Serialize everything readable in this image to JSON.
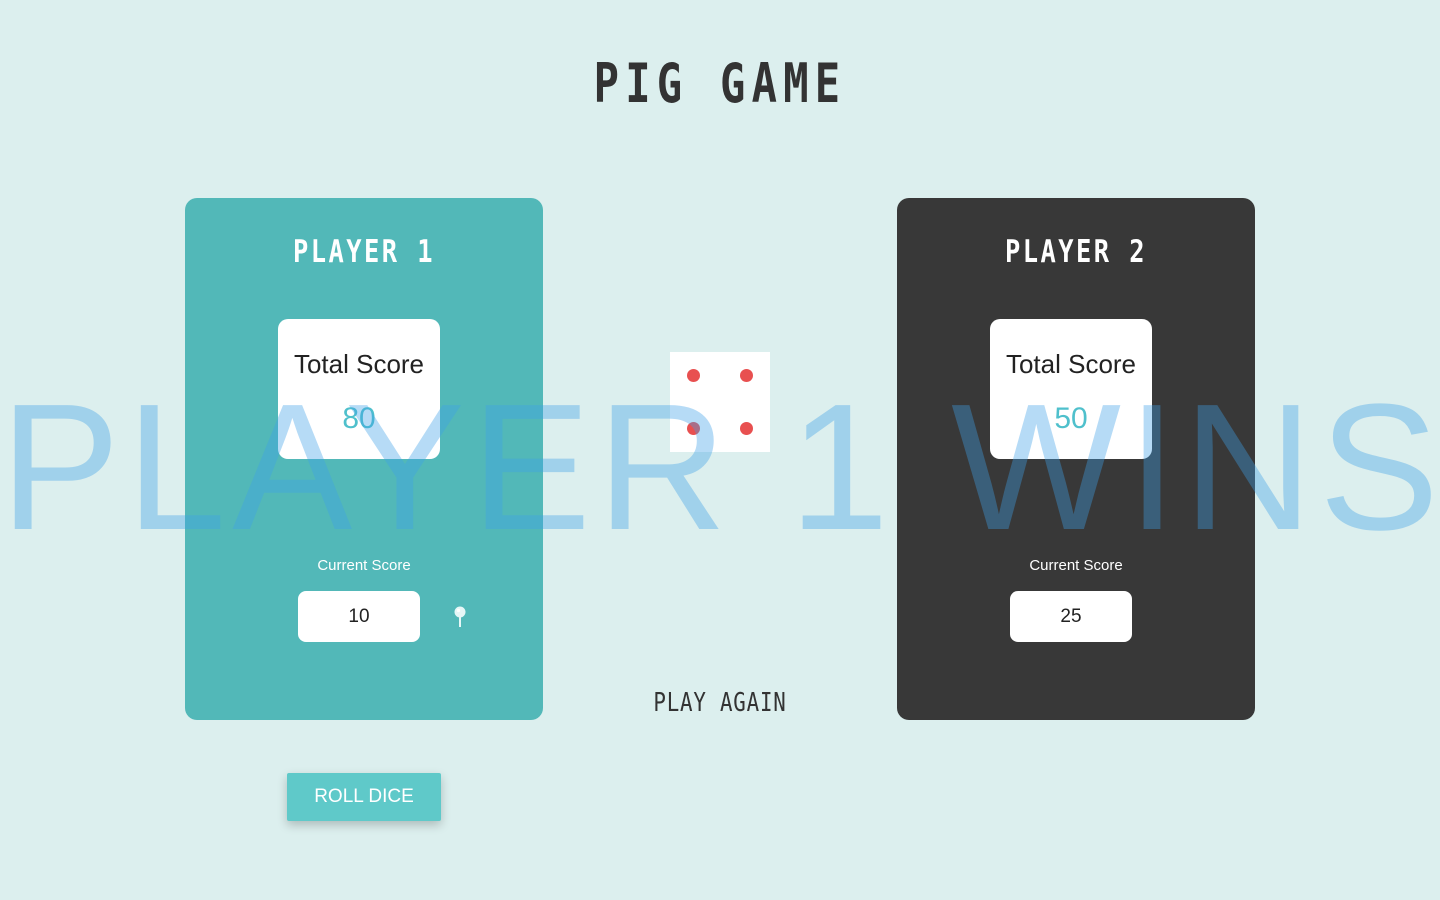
{
  "game": {
    "title": "PIG GAME",
    "winner_message": "PLAYER 1 WINS",
    "play_again_label": "PLAY AGAIN",
    "roll_dice_label": "ROLL DICE",
    "dice_value": 4,
    "active_player": 1
  },
  "players": [
    {
      "name": "PLAYER 1",
      "total_label": "Total Score",
      "total_score": "80",
      "current_label": "Current Score",
      "current_score": "10",
      "panel_color": "#52b8b8"
    },
    {
      "name": "PLAYER 2",
      "total_label": "Total Score",
      "total_score": "50",
      "current_label": "Current Score",
      "current_score": "25",
      "panel_color": "#383838"
    }
  ],
  "colors": {
    "background": "#dcefee",
    "accent": "#4fc0cc",
    "dice_pip": "#e85050",
    "winner_text": "#40a0e8"
  },
  "icons": {
    "active_player_indicator": "pushpin-icon"
  }
}
